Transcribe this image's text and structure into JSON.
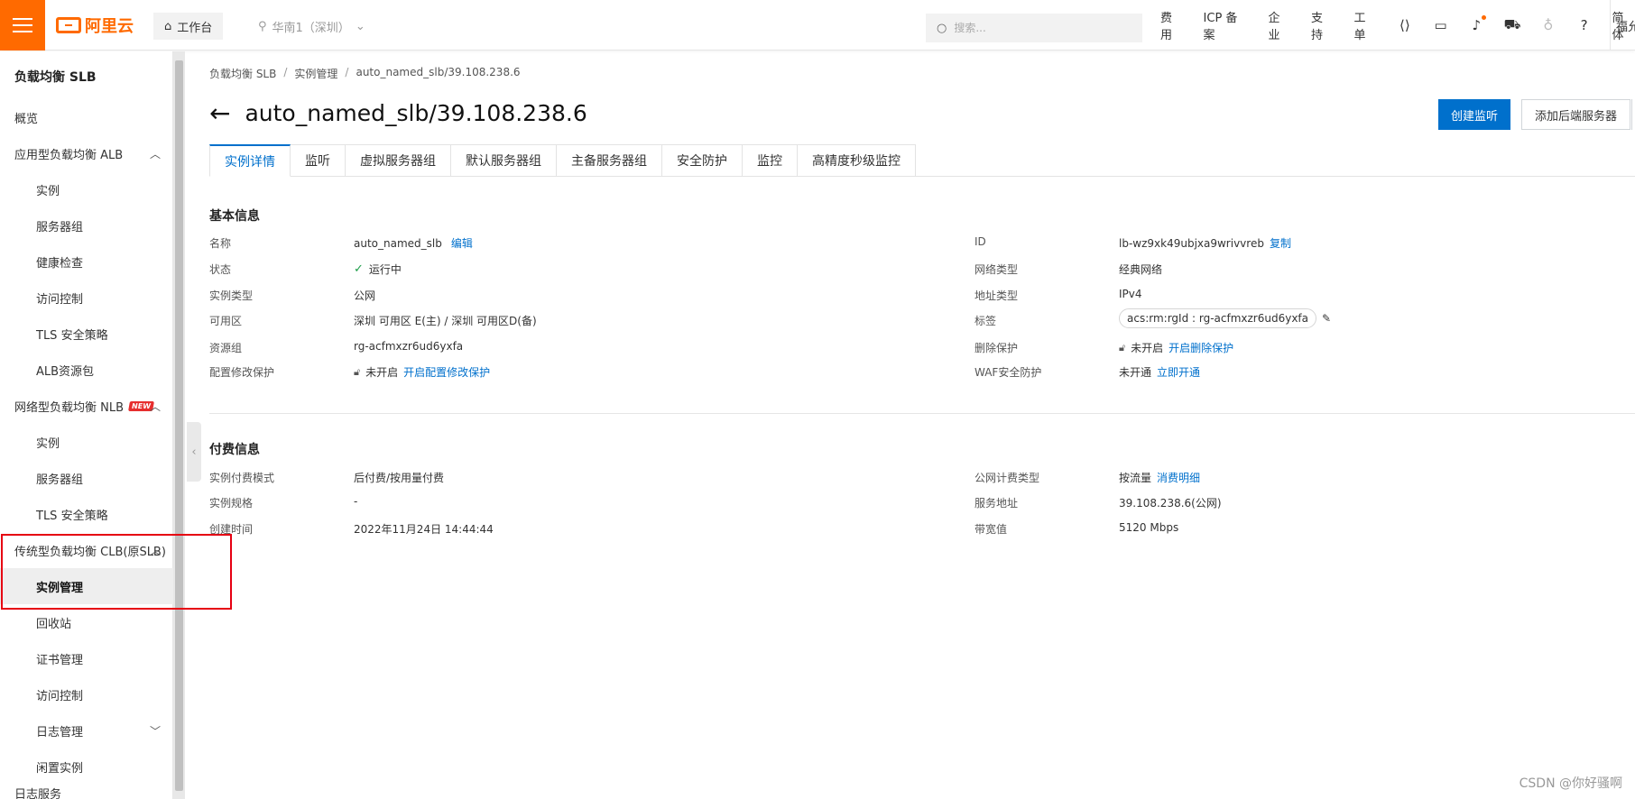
{
  "topbar": {
    "logo_text": "阿里云",
    "workbench": "工作台",
    "region": "华南1（深圳）",
    "search_placeholder": "搜索...",
    "links": [
      "费用",
      "ICP 备案",
      "企业",
      "支持",
      "工单"
    ],
    "lang": "简体",
    "user": "福允"
  },
  "sidebar": {
    "title": "负载均衡 SLB",
    "overview": "概览",
    "alb": {
      "label": "应用型负载均衡 ALB",
      "items": [
        "实例",
        "服务器组",
        "健康检查",
        "访问控制",
        "TLS 安全策略",
        "ALB资源包"
      ]
    },
    "nlb": {
      "label": "网络型负载均衡 NLB",
      "badge": "NEW",
      "items": [
        "实例",
        "服务器组",
        "TLS 安全策略"
      ]
    },
    "clb": {
      "label": "传统型负载均衡 CLB(原SLB)",
      "items": [
        "实例管理",
        "回收站",
        "证书管理",
        "访问控制",
        "日志管理",
        "闲置实例"
      ],
      "active_index": 0
    },
    "cutoff": "日志服务"
  },
  "breadcrumb": [
    "负载均衡 SLB",
    "实例管理",
    "auto_named_slb/39.108.238.6"
  ],
  "title": "auto_named_slb/39.108.238.6",
  "actions": {
    "create_listener": "创建监听",
    "add_backend": "添加后端服务器"
  },
  "tabs": [
    "实例详情",
    "监听",
    "虚拟服务器组",
    "默认服务器组",
    "主备服务器组",
    "安全防护",
    "监控",
    "高精度秒级监控"
  ],
  "basic": {
    "title": "基本信息",
    "left": {
      "name_label": "名称",
      "name_value": "auto_named_slb",
      "name_edit": "编辑",
      "status_label": "状态",
      "status_value": "运行中",
      "type_label": "实例类型",
      "type_value": "公网",
      "zone_label": "可用区",
      "zone_value": "深圳 可用区 E(主) / 深圳 可用区D(备)",
      "rg_label": "资源组",
      "rg_value": "rg-acfmxzr6ud6yxfa",
      "cfg_label": "配置修改保护",
      "cfg_value": "未开启",
      "cfg_link": "开启配置修改保护"
    },
    "right": {
      "id_label": "ID",
      "id_value": "lb-wz9xk49ubjxa9wrivvreb",
      "id_copy": "复制",
      "net_label": "网络类型",
      "net_value": "经典网络",
      "addr_label": "地址类型",
      "addr_value": "IPv4",
      "tag_label": "标签",
      "tag_value": "acs:rm:rgId : rg-acfmxzr6ud6yxfa",
      "del_label": "删除保护",
      "del_value": "未开启",
      "del_link": "开启删除保护",
      "waf_label": "WAF安全防护",
      "waf_value": "未开通",
      "waf_link": "立即开通"
    }
  },
  "billing": {
    "title": "付费信息",
    "left": {
      "mode_label": "实例付费模式",
      "mode_value": "后付费/按用量付费",
      "spec_label": "实例规格",
      "spec_value": "-",
      "created_label": "创建时间",
      "created_value": "2022年11月24日 14:44:44"
    },
    "right": {
      "inet_label": "公网计费类型",
      "inet_value": "按流量",
      "inet_link": "消费明细",
      "svc_label": "服务地址",
      "svc_value": "39.108.238.6(公网)",
      "bw_label": "带宽值",
      "bw_value": "5120 Mbps"
    }
  },
  "watermark": "CSDN @你好骚啊"
}
